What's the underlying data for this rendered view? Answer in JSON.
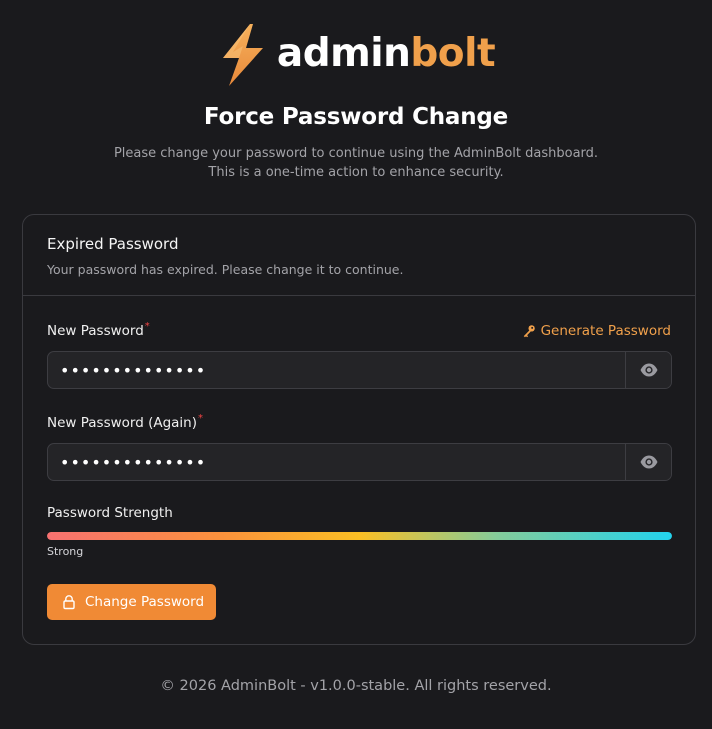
{
  "brand": {
    "name_part1": "admin",
    "name_part2": "bolt",
    "accent_color": "#f0a04b",
    "logo_icon": "lightning-bolt-icon"
  },
  "header": {
    "title": "Force Password Change",
    "subtitle_line1": "Please change your password to continue using the AdminBolt dashboard.",
    "subtitle_line2": "This is a one-time action to enhance security."
  },
  "card": {
    "title": "Expired Password",
    "description": "Your password has expired. Please change it to continue.",
    "new_password": {
      "label": "New Password",
      "required_mark": "*",
      "value": "••••••••••••••",
      "toggle_icon": "eye-icon"
    },
    "generate_link": {
      "label": "Generate Password",
      "icon": "key-icon"
    },
    "new_password_again": {
      "label": "New Password (Again)",
      "required_mark": "*",
      "value": "••••••••••••••",
      "toggle_icon": "eye-icon"
    },
    "strength": {
      "label": "Password Strength",
      "level_text": "Strong",
      "fraction": 1.0
    },
    "submit": {
      "label": "Change Password",
      "icon": "lock-icon",
      "color": "#f08a35"
    }
  },
  "footer": {
    "text": "© 2026 AdminBolt - v1.0.0-stable. All rights reserved."
  }
}
